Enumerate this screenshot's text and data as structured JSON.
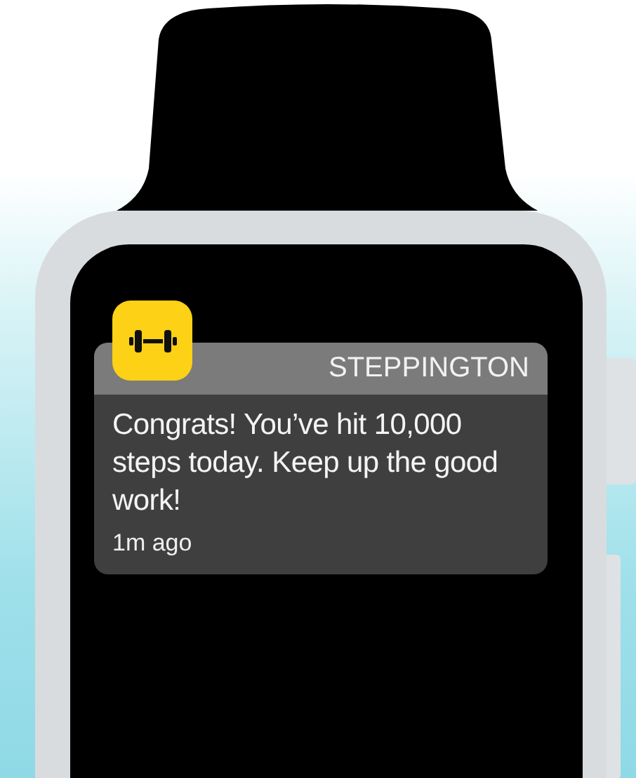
{
  "notification": {
    "app_name": "STEPPINGTON",
    "message": "Congrats! You’ve hit 10,000 steps today. Keep up the good work!",
    "time": "1m ago"
  }
}
